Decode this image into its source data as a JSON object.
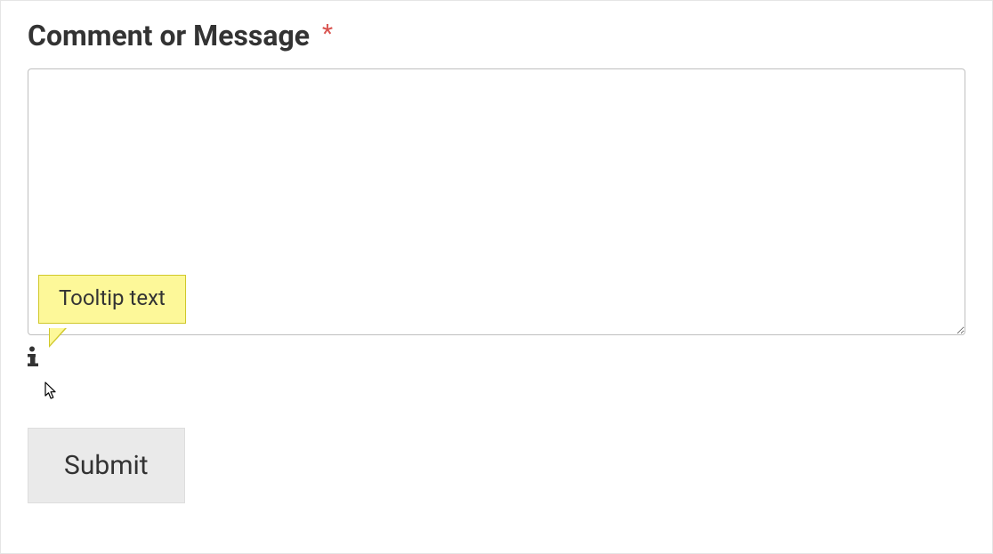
{
  "form": {
    "comment_field": {
      "label": "Comment or Message",
      "required_marker": "*",
      "value": "",
      "placeholder": ""
    },
    "tooltip": {
      "text": "Tooltip text"
    },
    "submit_label": "Submit",
    "icons": {
      "info": "info-icon",
      "cursor": "arrow-cursor"
    }
  }
}
